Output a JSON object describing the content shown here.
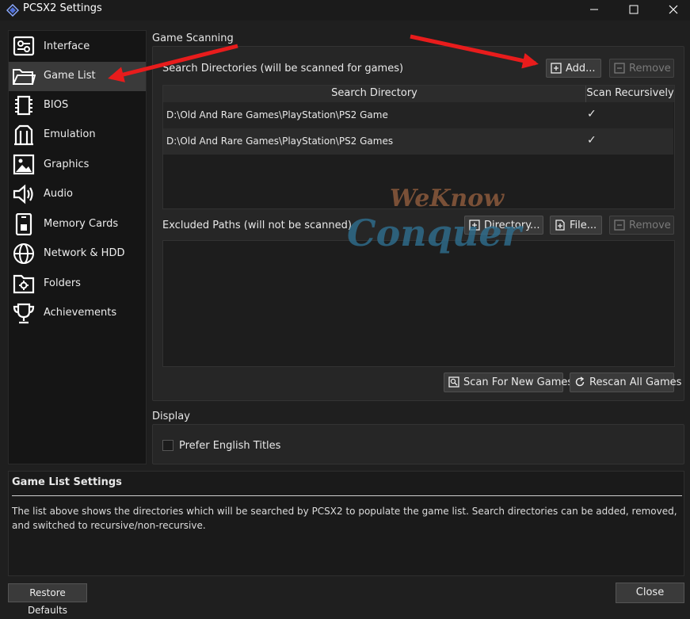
{
  "window": {
    "title": "PCSX2 Settings"
  },
  "sidebar": {
    "items": [
      {
        "label": "Interface",
        "icon": "interface-icon"
      },
      {
        "label": "Game List",
        "icon": "folder-icon"
      },
      {
        "label": "BIOS",
        "icon": "chip-icon"
      },
      {
        "label": "Emulation",
        "icon": "emulation-icon"
      },
      {
        "label": "Graphics",
        "icon": "image-icon"
      },
      {
        "label": "Audio",
        "icon": "speaker-icon"
      },
      {
        "label": "Memory Cards",
        "icon": "memory-card-icon"
      },
      {
        "label": "Network & HDD",
        "icon": "globe-icon"
      },
      {
        "label": "Folders",
        "icon": "folder-gear-icon"
      },
      {
        "label": "Achievements",
        "icon": "trophy-icon"
      }
    ],
    "selected": "Game List"
  },
  "game_scanning": {
    "title": "Game Scanning",
    "search_dirs_label": "Search Directories (will be scanned for games)",
    "add_label": "Add...",
    "remove_label": "Remove",
    "columns": [
      "Search Directory",
      "Scan Recursively"
    ],
    "rows": [
      {
        "path": "D:\\Old And Rare Games\\PlayStation\\PS2 Game",
        "recursive": "✓"
      },
      {
        "path": "D:\\Old And Rare Games\\PlayStation\\PS2 Games",
        "recursive": "✓"
      }
    ],
    "excluded_label": "Excluded Paths (will not be scanned)",
    "directory_label": "Directory...",
    "file_label": "File...",
    "remove2_label": "Remove",
    "scan_new_label": "Scan For New Games",
    "rescan_label": "Rescan All Games"
  },
  "display": {
    "title": "Display",
    "prefer_english_label": "Prefer English Titles",
    "prefer_english_checked": false
  },
  "info": {
    "title": "Game List Settings",
    "text": "The list above shows the directories which will be searched by PCSX2 to populate the game list. Search directories can be added, removed, and switched to recursive/non-recursive."
  },
  "watermark": {
    "line1": "WeKnow",
    "line2": "Conquer"
  },
  "footer": {
    "restore_label": "Restore Defaults",
    "close_label": "Close"
  },
  "colors": {
    "accent_arrow": "#e81c1c",
    "selected_nav": "#3a3a3a",
    "background": "#1f1f1f"
  }
}
